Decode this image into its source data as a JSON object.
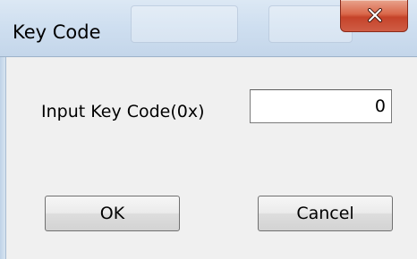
{
  "window": {
    "title": "Key Code",
    "close_icon": "close-x-icon"
  },
  "form": {
    "key_code_label": "Input Key Code(0x)",
    "key_code_value": "0"
  },
  "buttons": {
    "ok_label": "OK",
    "cancel_label": "Cancel"
  },
  "colors": {
    "close_button": "#c5432a",
    "title_bar": "#cfdff0",
    "dialog_background": "#f0f0f0"
  }
}
